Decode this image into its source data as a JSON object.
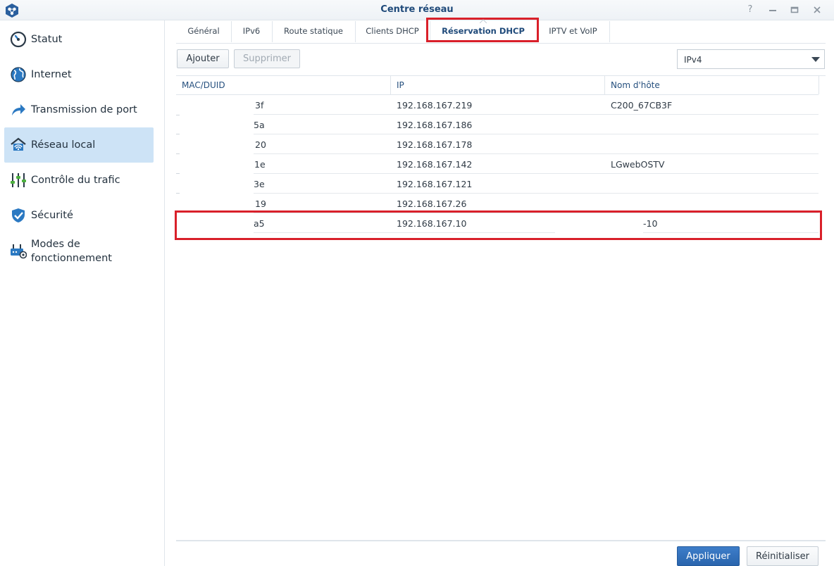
{
  "window": {
    "title": "Centre réseau",
    "help_label": "?",
    "colors": {
      "accent": "#1f4a7a",
      "selection": "#cde3f6",
      "highlight": "#d9202a",
      "primary_button": "#2f6db5"
    }
  },
  "sidebar": {
    "items": [
      {
        "label": "Statut",
        "icon": "gauge-icon"
      },
      {
        "label": "Internet",
        "icon": "globe-icon"
      },
      {
        "label": "Transmission de port",
        "icon": "share-arrow-icon"
      },
      {
        "label": "Réseau local",
        "icon": "home-network-icon",
        "active": true
      },
      {
        "label": "Contrôle du trafic",
        "icon": "sliders-icon"
      },
      {
        "label": "Sécurité",
        "icon": "shield-icon"
      },
      {
        "label": "Modes de fonctionnement",
        "line1": "Modes de",
        "line2": "fonctionnement",
        "icon": "router-gear-icon"
      }
    ]
  },
  "tabs": [
    {
      "label": "Général"
    },
    {
      "label": "IPv6"
    },
    {
      "label": "Route statique"
    },
    {
      "label": "Clients DHCP"
    },
    {
      "label": "Réservation DHCP",
      "active": true
    },
    {
      "label": "IPTV et VoIP"
    }
  ],
  "toolbar": {
    "add_label": "Ajouter",
    "delete_label": "Supprimer",
    "ip_version": "IPv4"
  },
  "table": {
    "columns": [
      "MAC/DUID",
      "IP",
      "Nom d'hôte"
    ],
    "rows": [
      {
        "mac": "3f",
        "ip": "192.168.167.219",
        "host": "C200_67CB3F"
      },
      {
        "mac": "5a",
        "ip": "192.168.167.186",
        "host": ""
      },
      {
        "mac": "20",
        "ip": "192.168.167.178",
        "host": ""
      },
      {
        "mac": "1e",
        "ip": "192.168.167.142",
        "host": "LGwebOSTV"
      },
      {
        "mac": "3e",
        "ip": "192.168.167.121",
        "host": ""
      },
      {
        "mac": "19",
        "ip": "192.168.167.26",
        "host": ""
      },
      {
        "mac": "a5",
        "ip": "192.168.167.10",
        "host": "-10",
        "highlighted": true
      }
    ]
  },
  "footer": {
    "apply_label": "Appliquer",
    "reset_label": "Réinitialiser"
  }
}
